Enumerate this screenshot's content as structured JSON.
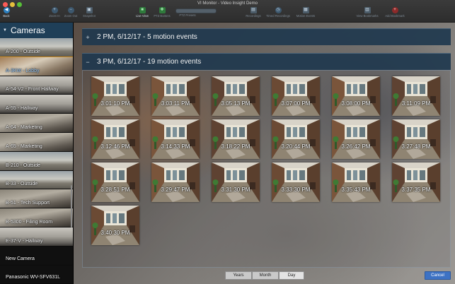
{
  "window": {
    "title": "VI Monitor - Video Insight Demo"
  },
  "toolbar": {
    "back": "Back",
    "zoom_in": "Zoom In",
    "zoom_out": "Zoom Out",
    "snapshot": "Snapshot",
    "live_view": "Live View",
    "ptz_buttons": "PTZ Buttons",
    "ptz_presets": "PTZ Presets",
    "recordings": "Recordings",
    "timed_recordings": "Timed Recordings",
    "motion_events": "Motion Events",
    "view_bookmarks": "View Bookmarks",
    "add_bookmark": "Add Bookmark"
  },
  "sidebar": {
    "title": "Cameras",
    "items": [
      {
        "label": "A-200 - Outside",
        "selected": false,
        "scene": "outdoor"
      },
      {
        "label": "A-3KW - Lobby",
        "selected": true,
        "scene": "lobby"
      },
      {
        "label": "A-54-V2 - Front Hallway",
        "selected": false,
        "scene": "hallway"
      },
      {
        "label": "A-55 - Hallway",
        "selected": false,
        "scene": "hallway"
      },
      {
        "label": "A-64 - Marketing",
        "selected": false,
        "scene": "office"
      },
      {
        "label": "A-65 - Marketing",
        "selected": false,
        "scene": "office"
      },
      {
        "label": "B-210 - Outside",
        "selected": false,
        "scene": "outdoor"
      },
      {
        "label": "B-33 - Outside",
        "selected": false,
        "scene": "outdoor"
      },
      {
        "label": "B-51 - Tech Support",
        "selected": false,
        "scene": "office"
      },
      {
        "label": "B-5300 - Filing Room",
        "selected": false,
        "scene": "office"
      },
      {
        "label": "E-37-V - Hallway",
        "selected": false,
        "scene": "hallway"
      },
      {
        "label": "New Camera",
        "selected": false,
        "scene": "empty"
      },
      {
        "label": "Panasonic WV-SFV631L",
        "selected": false,
        "scene": "empty"
      }
    ]
  },
  "groups": [
    {
      "toggle": "+",
      "label": "2 PM, 6/12/17  -  5 motion events",
      "expanded": false
    },
    {
      "toggle": "−",
      "label": "3 PM, 6/12/17  -  19 motion events",
      "expanded": true
    }
  ],
  "events": [
    "3:01:10 PM",
    "3:03:11 PM",
    "3:05:13 PM",
    "3:07:00 PM",
    "3:08:00 PM",
    "3:11:09 PM",
    "3:12:46 PM",
    "3:14:33 PM",
    "3:18:22 PM",
    "3:20:44 PM",
    "3:26:42 PM",
    "3:27:48 PM",
    "3:28:51 PM",
    "3:29:47 PM",
    "3:31:30 PM",
    "3:33:30 PM",
    "3:35:43 PM",
    "3:37:35 PM",
    "3:40:30 PM"
  ],
  "view_modes": {
    "years": "Years",
    "month": "Month",
    "day": "Day",
    "active": "day"
  },
  "actions": {
    "cancel": "Cancel"
  },
  "colors": {
    "accent": "#2c7fbf",
    "group_header": "#20384e",
    "selected_border": "#d18c1b",
    "cancel_button": "#3d72c4"
  }
}
